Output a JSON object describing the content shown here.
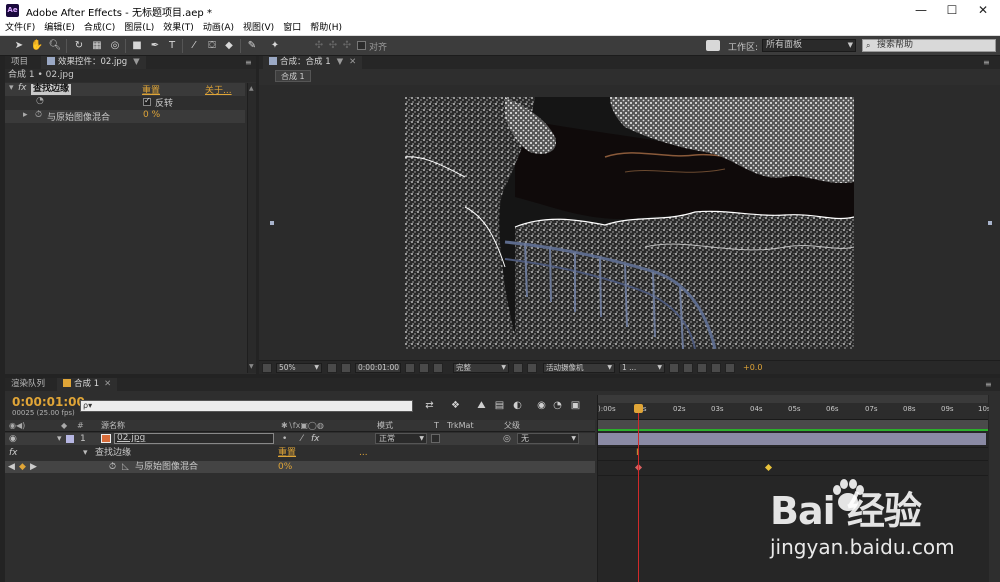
{
  "window": {
    "app_logo": "Ae",
    "title": "Adobe After Effects - 无标题项目.aep *",
    "minimize": "—",
    "maximize": "☐",
    "close": "✕"
  },
  "menu": [
    "文件(F)",
    "编辑(E)",
    "合成(C)",
    "图层(L)",
    "效果(T)",
    "动画(A)",
    "视图(V)",
    "窗口",
    "帮助(H)"
  ],
  "toolbar": {
    "snap_label": "对齐",
    "workspace_label": "工作区:",
    "workspace_value": "所有面板",
    "help_placeholder": "搜索帮助"
  },
  "left_panel": {
    "tab_project": "项目",
    "tab_effects": "效果控件：02.jpg",
    "header": "合成 1 • 02.jpg",
    "effect_name": "查找边缘",
    "reset_label": "重置",
    "about_label": "关于...",
    "invert_label": "反转",
    "blend_label": "与原始图像混合",
    "blend_value": "0 %"
  },
  "comp_panel": {
    "tab": "合成：合成 1",
    "subtab": "合成 1",
    "zoom": "50%",
    "timecode": "0:00:01:00",
    "resolution": "完整",
    "camera": "活动摄像机",
    "views": "1 ...",
    "exposure": "+0.0"
  },
  "timeline": {
    "tab_render": "渲染队列",
    "tab_comp": "合成 1",
    "current_time": "0:00:01:00",
    "frame_info": "00025 (25.00 fps)",
    "search_placeholder": "ρ▾",
    "col_source": "源名称",
    "col_mode": "模式",
    "col_t": "T",
    "col_trkmat": "TrkMat",
    "col_parent": "父级",
    "layer_num": "1",
    "layer_name": "02.jpg",
    "layer_mode": "正常",
    "layer_parent": "无",
    "fx_name": "查找边缘",
    "fx_reset": "重置",
    "fx_dots": "...",
    "blend_prop": "与原始图像混合",
    "blend_value": "0%",
    "ruler_labels": [
      "):00s",
      "01s",
      "02s",
      "03s",
      "04s",
      "05s",
      "06s",
      "07s",
      "08s",
      "09s",
      "10s"
    ]
  },
  "watermark": {
    "logo": "Bai 经验",
    "url": "jingyan.baidu.com"
  }
}
